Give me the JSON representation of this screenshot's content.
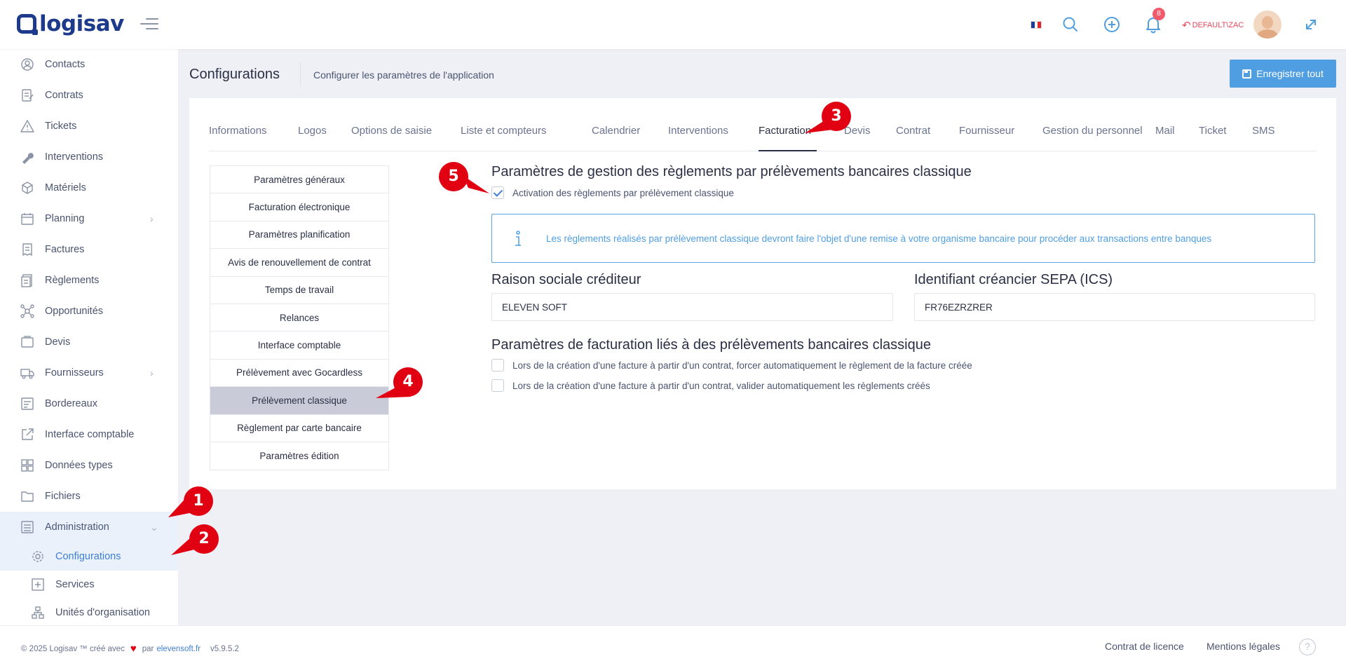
{
  "app": {
    "logo_text": "logisav"
  },
  "header": {
    "notifications_count": "8",
    "user_label": "DEFAULT\\ZAC",
    "flag_colors": [
      "#1f3b9a",
      "#ffffff",
      "#e1262d"
    ]
  },
  "sidebar": {
    "items": [
      {
        "label": "Contacts",
        "icon": "contacts-icon"
      },
      {
        "label": "Contrats",
        "icon": "contracts-icon"
      },
      {
        "label": "Tickets",
        "icon": "warning-icon"
      },
      {
        "label": "Interventions",
        "icon": "wrench-icon"
      },
      {
        "label": "Matériels",
        "icon": "box-icon"
      },
      {
        "label": "Planning",
        "icon": "calendar-icon"
      },
      {
        "label": "Factures",
        "icon": "invoice-icon"
      },
      {
        "label": "Règlements",
        "icon": "payments-icon"
      },
      {
        "label": "Opportunités",
        "icon": "opportunities-icon"
      },
      {
        "label": "Devis",
        "icon": "quote-icon"
      },
      {
        "label": "Fournisseurs",
        "icon": "truck-icon"
      },
      {
        "label": "Bordereaux",
        "icon": "slips-icon"
      },
      {
        "label": "Interface comptable",
        "icon": "external-link-icon"
      },
      {
        "label": "Données types",
        "icon": "grid-icon"
      },
      {
        "label": "Fichiers",
        "icon": "folder-icon"
      },
      {
        "label": "Administration",
        "icon": "admin-icon"
      }
    ],
    "sub_items": [
      {
        "label": "Configurations",
        "icon": "gear-icon"
      },
      {
        "label": "Services",
        "icon": "services-icon"
      },
      {
        "label": "Unités d'organisation",
        "icon": "org-chart-icon"
      }
    ]
  },
  "page": {
    "title": "Configurations",
    "subtitle": "Configurer les paramètres de l'application",
    "save_all": "Enregistrer tout"
  },
  "tabs": [
    "Informations",
    "Logos",
    "Options de saisie",
    "Liste et compteurs",
    "Calendrier",
    "Interventions",
    "Facturation",
    "Devis",
    "Contrat",
    "Fournisseur",
    "Gestion du personnel",
    "Mail",
    "Ticket",
    "SMS"
  ],
  "active_tab": "Facturation",
  "subnav": [
    "Paramètres généraux",
    "Facturation électronique",
    "Paramètres planification",
    "Avis de renouvellement de contrat",
    "Temps de travail",
    "Relances",
    "Interface comptable",
    "Prélèvement avec Gocardless",
    "Prélèvement classique",
    "Règlement par carte bancaire",
    "Paramètres édition"
  ],
  "active_subnav": "Prélèvement classique",
  "content": {
    "section1_title": "Paramètres de gestion des règlements par prélèvements bancaires classique",
    "activation_label": "Activation des règlements par prélèvement classique",
    "info_text": "Les règlements réalisés par prélèvement classique devront faire l'objet d'une remise à votre organisme bancaire pour procéder aux transactions entre banques",
    "creditor_label": "Raison sociale créditeur",
    "creditor_value": "ELEVEN SOFT",
    "sepa_label": "Identifiant créancier SEPA (ICS)",
    "sepa_value": "FR76EZRZRER",
    "section2_title": "Paramètres de facturation liés à des prélèvements bancaires classique",
    "opt1_label": "Lors de la création d'une facture à partir d'un contrat, forcer automatiquement le règlement de la facture créée",
    "opt2_label": "Lors de la création d'une facture à partir d'un contrat, valider automatiquement les règlements créés"
  },
  "badges": [
    "1",
    "2",
    "3",
    "4",
    "5"
  ],
  "footer": {
    "copyright": "© 2025 Logisav ™ créé avec",
    "par": "par",
    "link": "elevensoft.fr",
    "version": "v5.9.5.2",
    "license": "Contrat de licence",
    "legal": "Mentions légales",
    "help": "?"
  },
  "colors": {
    "accent": "#4f9ee2",
    "badge": "#e10012",
    "brand": "#1e3a8a"
  }
}
